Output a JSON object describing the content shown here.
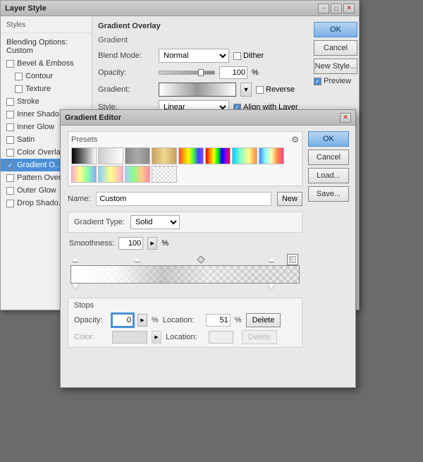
{
  "layerStyle": {
    "title": "Layer Style",
    "sidebar": {
      "heading": "Styles",
      "blending": "Blending Options: Custom",
      "items": [
        {
          "label": "Bevel & Emboss",
          "checked": false,
          "sub": false
        },
        {
          "label": "Contour",
          "checked": false,
          "sub": true
        },
        {
          "label": "Texture",
          "checked": false,
          "sub": true
        },
        {
          "label": "Stroke",
          "checked": false,
          "sub": false
        },
        {
          "label": "Inner Shadow",
          "checked": false,
          "sub": false
        },
        {
          "label": "Inner Glow",
          "checked": false,
          "sub": false
        },
        {
          "label": "Satin",
          "checked": false,
          "sub": false
        },
        {
          "label": "Color Overlay",
          "checked": false,
          "sub": false
        },
        {
          "label": "Gradient O...",
          "checked": true,
          "sub": false,
          "active": true
        },
        {
          "label": "Pattern Over...",
          "checked": false,
          "sub": false
        },
        {
          "label": "Outer Glow",
          "checked": false,
          "sub": false
        },
        {
          "label": "Drop Shadow",
          "checked": false,
          "sub": false
        }
      ]
    },
    "buttons": {
      "ok": "OK",
      "cancel": "Cancel",
      "newStyle": "New Style...",
      "preview": "Preview"
    },
    "panel": {
      "title": "Gradient Overlay",
      "subtitle": "Gradient",
      "blendModeLabel": "Blend Mode:",
      "blendModeValue": "Normal",
      "dither": "Dither",
      "opacityLabel": "Opacity:",
      "opacityValue": "100",
      "opacityPct": "%",
      "gradientLabel": "Gradient:",
      "reverseLabel": "Reverse",
      "styleLabel": "Style:",
      "styleValue": "Linear",
      "alignLabel": "Align with Layer"
    }
  },
  "gradientEditor": {
    "title": "Gradient Editor",
    "presetsLabel": "Presets",
    "nameLabel": "Name:",
    "nameValue": "Custom",
    "newBtn": "New",
    "typeLabel": "Gradient Type:",
    "typeValue": "Solid",
    "smoothLabel": "Smoothness:",
    "smoothValue": "100",
    "smoothPct": "%",
    "buttons": {
      "ok": "OK",
      "cancel": "Cancel",
      "load": "Load...",
      "save": "Save..."
    },
    "stops": {
      "title": "Stops",
      "opacityLabel": "Opacity:",
      "opacityValue": "0",
      "opacityPct": "%",
      "locationLabel": "Location:",
      "locationValue": "51",
      "locationPct": "%",
      "deleteBtn": "Delete",
      "colorLabel": "Color:",
      "colorLocation": "",
      "colorLocationPct": "%",
      "colorDeleteBtn": "Delete"
    }
  }
}
